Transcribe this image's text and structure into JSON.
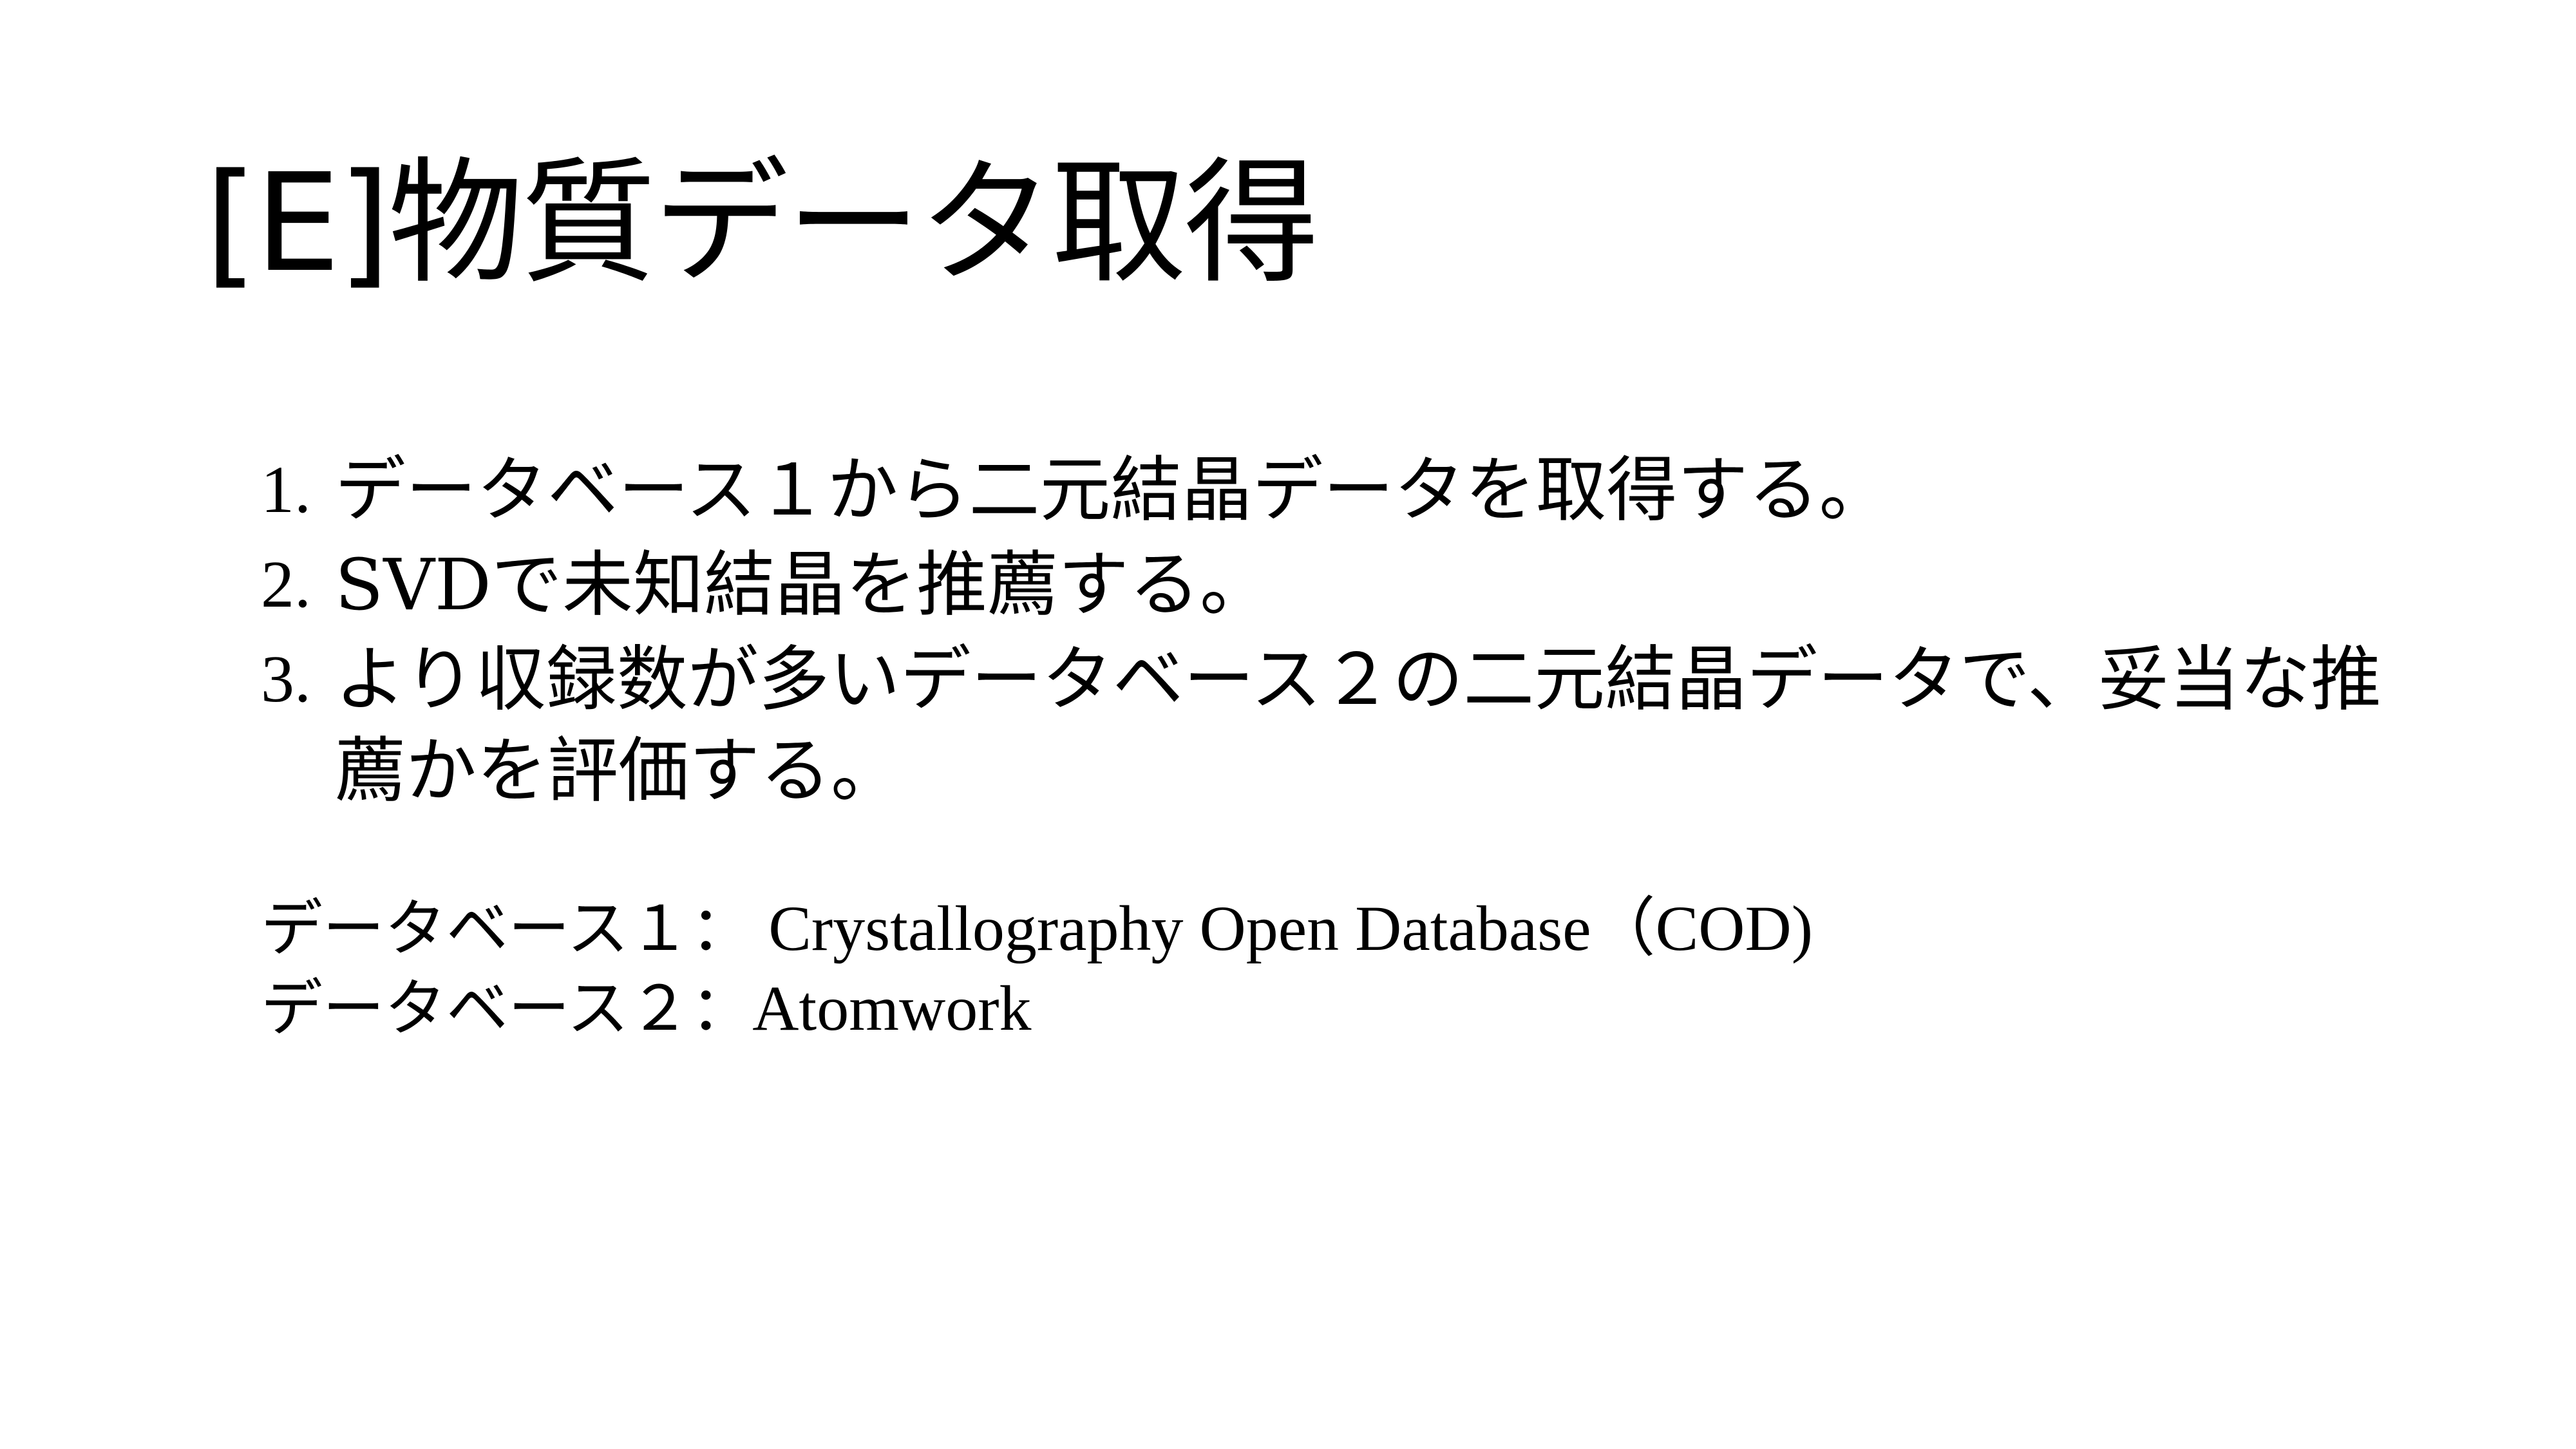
{
  "slide": {
    "title": "[E]物質データ取得",
    "steps": [
      {
        "number": "1.",
        "text": "データベース１から二元結晶データを取得する。"
      },
      {
        "number": "2.",
        "text": "SVDで未知結晶を推薦する。"
      },
      {
        "number": "3.",
        "text": "より収録数が多いデータベース２の二元結晶データで、妥当な推薦かを評価する。"
      }
    ],
    "sources": [
      {
        "label": "データベース１：",
        "value": " Crystallography Open Database（COD)"
      },
      {
        "label": "データベース２：",
        "value": "Atomwork"
      }
    ]
  }
}
